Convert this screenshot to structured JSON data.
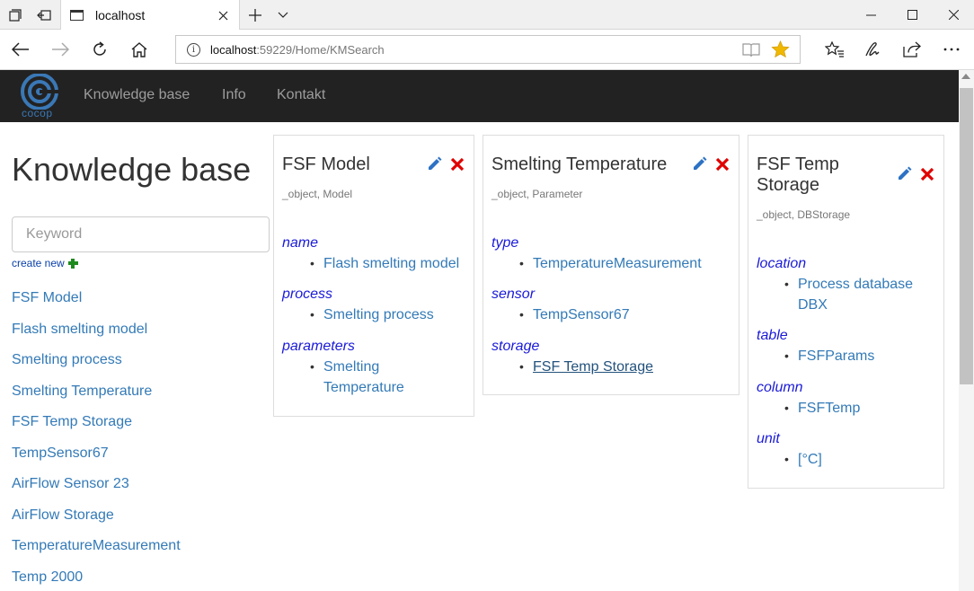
{
  "browser": {
    "tab_title": "localhost",
    "url_host": "localhost",
    "url_rest": ":59229/Home/KMSearch"
  },
  "site": {
    "logo_text": "cocop",
    "nav": [
      "Knowledge base",
      "Info",
      "Kontakt"
    ]
  },
  "sidebar": {
    "title": "Knowledge base",
    "search_placeholder": "Keyword",
    "create_new": "create new",
    "items": [
      "FSF Model",
      "Flash smelting model",
      "Smelting process",
      "Smelting Temperature",
      "FSF Temp Storage",
      "TempSensor67",
      "AirFlow Sensor 23",
      "AirFlow Storage",
      "TemperatureMeasurement",
      "Temp 2000"
    ]
  },
  "cards": [
    {
      "title": "FSF Model",
      "meta": "_object, Model",
      "props": [
        {
          "key": "name",
          "values": [
            "Flash smelting model"
          ]
        },
        {
          "key": "process",
          "values": [
            "Smelting process"
          ]
        },
        {
          "key": "parameters",
          "values": [
            "Smelting Temperature"
          ]
        }
      ]
    },
    {
      "title": "Smelting Temperature",
      "meta": "_object, Parameter",
      "props": [
        {
          "key": "type",
          "values": [
            "TemperatureMeasurement"
          ]
        },
        {
          "key": "sensor",
          "values": [
            "TempSensor67"
          ]
        },
        {
          "key": "storage",
          "values": [
            "FSF Temp Storage"
          ]
        }
      ]
    },
    {
      "title": "FSF Temp Storage",
      "meta": "_object, DBStorage",
      "props": [
        {
          "key": "location",
          "values": [
            "Process database DBX"
          ]
        },
        {
          "key": "table",
          "values": [
            "FSFParams"
          ]
        },
        {
          "key": "column",
          "values": [
            "FSFTemp"
          ]
        },
        {
          "key": "unit",
          "values": [
            "[°C]"
          ]
        }
      ]
    }
  ],
  "colors": {
    "link": "#337ab7",
    "prop_key": "#1a1ad8",
    "navbar": "#222222",
    "edit_icon": "#2d72c4",
    "delete_icon": "#e00000",
    "create_icon": "#1e8a1e"
  }
}
